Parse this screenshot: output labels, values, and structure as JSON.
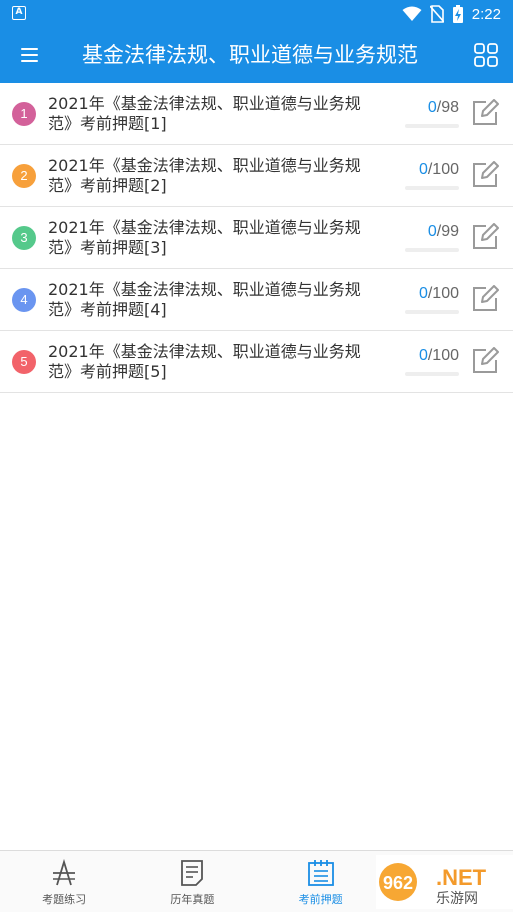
{
  "status_bar": {
    "time": "2:22",
    "app_badge": "A"
  },
  "app_bar": {
    "title": "基金法律法规、职业道德与业务规范"
  },
  "colors": {
    "primary": "#1a8ee5",
    "badges": [
      "#d3619a",
      "#f7a03b",
      "#55c98b",
      "#6a95f0",
      "#f2636a"
    ]
  },
  "list": {
    "items": [
      {
        "index": "1",
        "title": "2021年《基金法律法规、职业道德与业务规范》考前押题[1]",
        "done": "0",
        "total": "/98",
        "progress": 0
      },
      {
        "index": "2",
        "title": "2021年《基金法律法规、职业道德与业务规范》考前押题[2]",
        "done": "0",
        "total": "/100",
        "progress": 0
      },
      {
        "index": "3",
        "title": "2021年《基金法律法规、职业道德与业务规范》考前押题[3]",
        "done": "0",
        "total": "/99",
        "progress": 0
      },
      {
        "index": "4",
        "title": "2021年《基金法律法规、职业道德与业务规范》考前押题[4]",
        "done": "0",
        "total": "/100",
        "progress": 0
      },
      {
        "index": "5",
        "title": "2021年《基金法律法规、职业道德与业务规范》考前押题[5]",
        "done": "0",
        "total": "/100",
        "progress": 0
      }
    ]
  },
  "bottom_nav": {
    "tabs": [
      {
        "label": "考题练习",
        "icon": "compass-icon",
        "active": false
      },
      {
        "label": "历年真题",
        "icon": "document-icon",
        "active": false
      },
      {
        "label": "考前押题",
        "icon": "calendar-list-icon",
        "active": true
      }
    ]
  },
  "watermark": {
    "text": "962.NET",
    "subtext": "乐游网"
  }
}
